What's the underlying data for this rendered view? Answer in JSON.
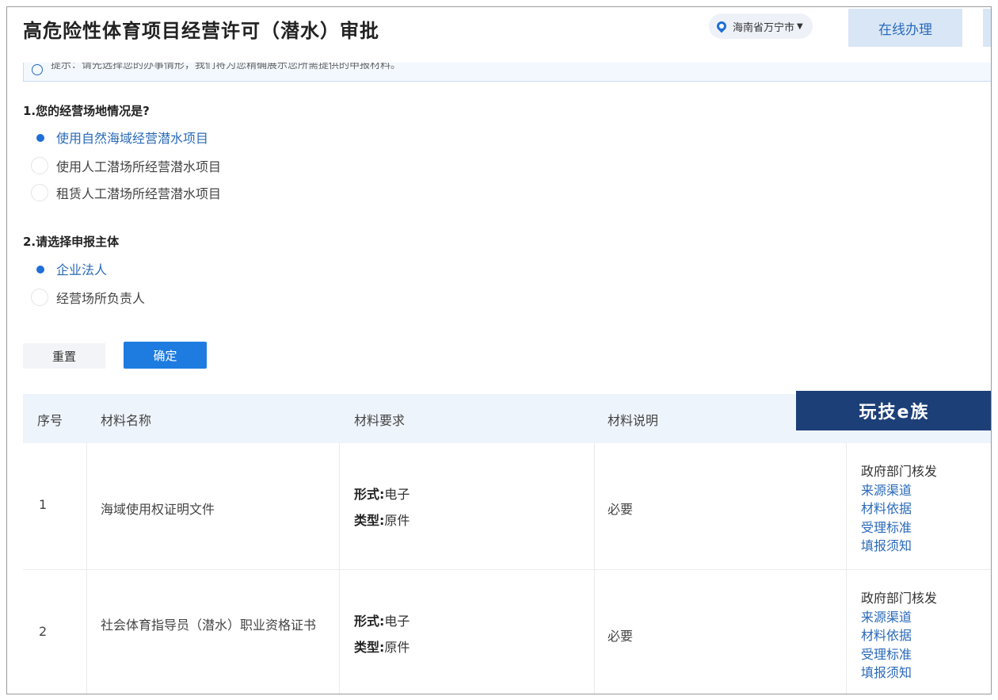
{
  "header": {
    "title": "高危险性体育项目经营许可（潜水）审批",
    "region": "海南省万宁市",
    "online_button": "在线办理"
  },
  "tip": {
    "text": "提示：请先选择您的办事情形，我们将为您精确展示您所需提供的申报材料。"
  },
  "questions": [
    {
      "label": "1.您的经营场地情况是?",
      "options": [
        {
          "label": "使用自然海域经营潜水项目",
          "selected": true
        },
        {
          "label": "使用人工潜场所经营潜水项目",
          "selected": false
        },
        {
          "label": "租赁人工潜场所经营潜水项目",
          "selected": false
        }
      ]
    },
    {
      "label": "2.请选择申报主体",
      "options": [
        {
          "label": "企业法人",
          "selected": true
        },
        {
          "label": "经营场所负责人",
          "selected": false
        }
      ]
    }
  ],
  "buttons": {
    "reset": "重置",
    "confirm": "确定"
  },
  "table": {
    "columns": [
      "序号",
      "材料名称",
      "材料要求",
      "材料说明"
    ],
    "rows": [
      {
        "index": "1",
        "name": "海域使用权证明文件",
        "form_label": "形式:",
        "form_value": "电子",
        "type_label": "类型:",
        "type_value": "原件",
        "note": "必要",
        "source": "政府部门核发",
        "links": [
          "来源渠道",
          "材料依据",
          "受理标准",
          "填报须知"
        ]
      },
      {
        "index": "2",
        "name": "社会体育指导员（潜水）职业资格证书",
        "form_label": "形式:",
        "form_value": "电子",
        "type_label": "类型:",
        "type_value": "原件",
        "note": "必要",
        "source": "政府部门核发",
        "links": [
          "来源渠道",
          "材料依据",
          "受理标准",
          "填报须知"
        ]
      }
    ]
  },
  "watermark": "玩技e族",
  "colors": {
    "accent": "#1e7be0",
    "link": "#2a6ab8",
    "header_bg": "#eef4fb"
  }
}
